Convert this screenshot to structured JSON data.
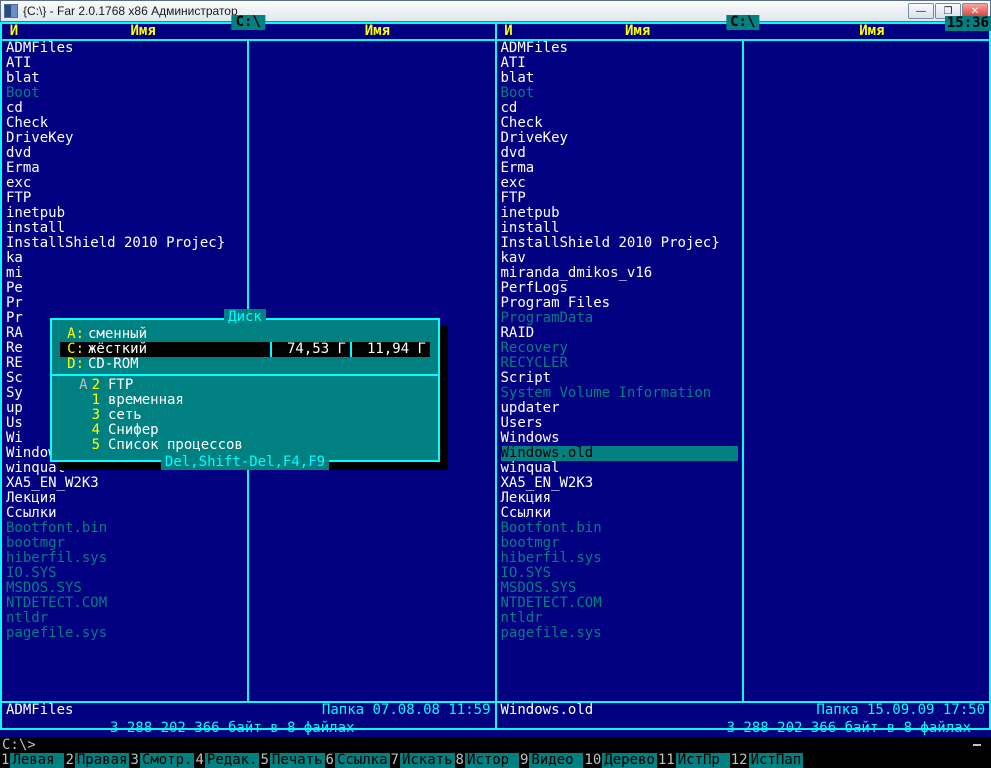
{
  "window": {
    "title": "{C:\\} - Far 2.0.1768 x86 Администратор"
  },
  "clock": "15:36",
  "left_panel": {
    "path": "C:\\",
    "headers": {
      "mark": "И",
      "name": "Имя"
    },
    "files": [
      {
        "name": "ADMFiles",
        "cls": ""
      },
      {
        "name": "ATI",
        "cls": ""
      },
      {
        "name": "blat",
        "cls": ""
      },
      {
        "name": "Boot",
        "cls": "dim"
      },
      {
        "name": "cd",
        "cls": ""
      },
      {
        "name": "Check",
        "cls": ""
      },
      {
        "name": "DriveKey",
        "cls": ""
      },
      {
        "name": "dvd",
        "cls": ""
      },
      {
        "name": "Erma",
        "cls": ""
      },
      {
        "name": "exc",
        "cls": ""
      },
      {
        "name": "FTP",
        "cls": ""
      },
      {
        "name": "inetpub",
        "cls": ""
      },
      {
        "name": "install",
        "cls": ""
      },
      {
        "name": "InstallShield 2010 Projec",
        "cls": "",
        "curly": true
      },
      {
        "name": "ka",
        "cls": ""
      },
      {
        "name": "mi",
        "cls": ""
      },
      {
        "name": "Pe",
        "cls": ""
      },
      {
        "name": "Pr",
        "cls": ""
      },
      {
        "name": "Pr",
        "cls": ""
      },
      {
        "name": "RA",
        "cls": ""
      },
      {
        "name": "Re",
        "cls": ""
      },
      {
        "name": "RE",
        "cls": ""
      },
      {
        "name": "Sc",
        "cls": ""
      },
      {
        "name": "Sy",
        "cls": ""
      },
      {
        "name": "up",
        "cls": ""
      },
      {
        "name": "Us",
        "cls": ""
      },
      {
        "name": "Wi",
        "cls": ""
      },
      {
        "name": "Windows.old",
        "cls": ""
      },
      {
        "name": "winqual",
        "cls": ""
      },
      {
        "name": "XA5_EN_W2K3",
        "cls": ""
      },
      {
        "name": "Лекция",
        "cls": ""
      },
      {
        "name": "Ссылки",
        "cls": ""
      },
      {
        "name": "Bootfont.bin",
        "cls": "dim"
      },
      {
        "name": "bootmgr",
        "cls": "dim"
      },
      {
        "name": "hiberfil.sys",
        "cls": "dim"
      },
      {
        "name": "IO.SYS",
        "cls": "dim"
      },
      {
        "name": "MSDOS.SYS",
        "cls": "dim"
      },
      {
        "name": "NTDETECT.COM",
        "cls": "dim"
      },
      {
        "name": "ntldr",
        "cls": "dim"
      },
      {
        "name": "pagefile.sys",
        "cls": "dim"
      }
    ],
    "footer_name": "ADMFiles",
    "footer_info": "Папка 07.08.08 11:59",
    "status": "3 288 202 366 байт в 8 файлах"
  },
  "right_panel": {
    "path": "C:\\",
    "headers": {
      "mark": "И",
      "name": "Имя"
    },
    "files": [
      {
        "name": "ADMFiles",
        "cls": ""
      },
      {
        "name": "ATI",
        "cls": ""
      },
      {
        "name": "blat",
        "cls": ""
      },
      {
        "name": "Boot",
        "cls": "dim"
      },
      {
        "name": "cd",
        "cls": ""
      },
      {
        "name": "Check",
        "cls": ""
      },
      {
        "name": "DriveKey",
        "cls": ""
      },
      {
        "name": "dvd",
        "cls": ""
      },
      {
        "name": "Erma",
        "cls": ""
      },
      {
        "name": "exc",
        "cls": ""
      },
      {
        "name": "FTP",
        "cls": ""
      },
      {
        "name": "inetpub",
        "cls": ""
      },
      {
        "name": "install",
        "cls": ""
      },
      {
        "name": "InstallShield 2010 Projec",
        "cls": "",
        "curly": true
      },
      {
        "name": "kav",
        "cls": ""
      },
      {
        "name": "miranda_dmikos_v16",
        "cls": ""
      },
      {
        "name": "PerfLogs",
        "cls": ""
      },
      {
        "name": "Program Files",
        "cls": ""
      },
      {
        "name": "ProgramData",
        "cls": "dim"
      },
      {
        "name": "RAID",
        "cls": ""
      },
      {
        "name": "Recovery",
        "cls": "dim"
      },
      {
        "name": "RECYCLER",
        "cls": "dim"
      },
      {
        "name": "Script",
        "cls": ""
      },
      {
        "name": "System Volume Information",
        "cls": "dim"
      },
      {
        "name": "updater",
        "cls": ""
      },
      {
        "name": "Users",
        "cls": ""
      },
      {
        "name": "Windows",
        "cls": ""
      },
      {
        "name": "Windows.old",
        "cls": "selected"
      },
      {
        "name": "winqual",
        "cls": ""
      },
      {
        "name": "XA5_EN_W2K3",
        "cls": ""
      },
      {
        "name": "Лекция",
        "cls": ""
      },
      {
        "name": "Ссылки",
        "cls": ""
      },
      {
        "name": "Bootfont.bin",
        "cls": "dim"
      },
      {
        "name": "bootmgr",
        "cls": "dim"
      },
      {
        "name": "hiberfil.sys",
        "cls": "dim"
      },
      {
        "name": "IO.SYS",
        "cls": "dim"
      },
      {
        "name": "MSDOS.SYS",
        "cls": "dim"
      },
      {
        "name": "NTDETECT.COM",
        "cls": "dim"
      },
      {
        "name": "ntldr",
        "cls": "dim"
      },
      {
        "name": "pagefile.sys",
        "cls": "dim"
      }
    ],
    "footer_name": "Windows.old",
    "footer_info": "Папка 15.09.09 17:50",
    "status": "3 288 202 366 байт в 8 файлах"
  },
  "dialog": {
    "title": " Диск ",
    "drives": [
      {
        "letter": "A:",
        "type": "сменный",
        "size": "",
        "free": "",
        "sel": false
      },
      {
        "letter": "C:",
        "type": "жёсткий",
        "size": "74,53 Г",
        "free": "11,94 Г",
        "sel": true
      },
      {
        "letter": "D:",
        "type": "CD-ROM",
        "size": "",
        "free": "",
        "sel": false
      }
    ],
    "plugins": [
      {
        "hot": "A",
        "num": "2",
        "name": "FTP"
      },
      {
        "hot": "",
        "num": "1",
        "name": "временная"
      },
      {
        "hot": "",
        "num": "3",
        "name": "сеть"
      },
      {
        "hot": "",
        "num": "4",
        "name": "Снифер"
      },
      {
        "hot": "",
        "num": "5",
        "name": "Список процессов"
      }
    ],
    "hint": " Del,Shift-Del,F4,F9 "
  },
  "cmdline": "C:\\>",
  "fkeys": [
    {
      "num": "1",
      "label": "Левая "
    },
    {
      "num": "2",
      "label": "Правая"
    },
    {
      "num": "3",
      "label": "Смотр."
    },
    {
      "num": "4",
      "label": "Редак."
    },
    {
      "num": "5",
      "label": "Печать"
    },
    {
      "num": "6",
      "label": "Ссылка"
    },
    {
      "num": "7",
      "label": "Искать"
    },
    {
      "num": "8",
      "label": "Истор "
    },
    {
      "num": "9",
      "label": "Видео "
    },
    {
      "num": "10",
      "label": "Дерево"
    },
    {
      "num": "11",
      "label": "ИстПр "
    },
    {
      "num": "12",
      "label": "ИстПап"
    }
  ]
}
